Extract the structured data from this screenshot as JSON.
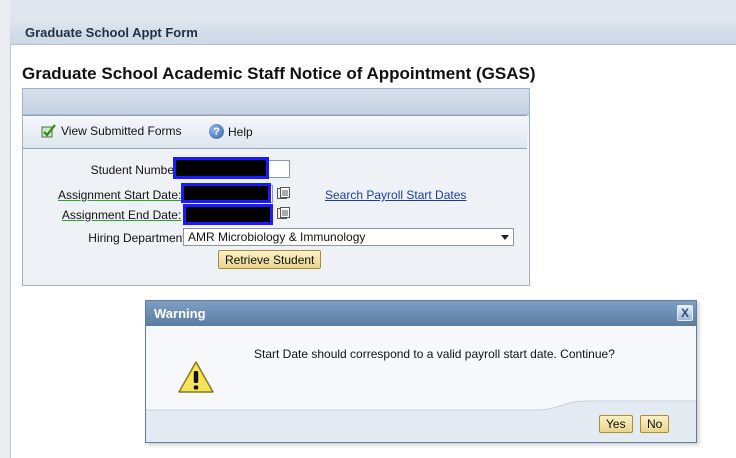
{
  "window_title": "Graduate School Appt Form",
  "page_title": "Graduate School Academic Staff Notice of Appointment (GSAS)",
  "toolbar": {
    "view_submitted": "View Submitted Forms",
    "help": "Help"
  },
  "form": {
    "student_number_label": "Student Number:",
    "start_date_label": "Assignment Start Date:",
    "end_date_label": "Assignment End Date:",
    "hiring_dept_label": "Hiring Department:",
    "required_mark": "*",
    "search_link": "Search Payroll Start Dates",
    "hiring_dept_value": "AMR Microbiology & Immunology",
    "retrieve_button": "Retrieve Student"
  },
  "dialog": {
    "title": "Warning",
    "close": "X",
    "message": "Start Date should correspond to a valid payroll start date. Continue?",
    "yes": "Yes",
    "no": "No"
  },
  "colors": {
    "accent": "#5a7ca3",
    "required": "#cc0000",
    "link": "#1a3da0",
    "button": "#ead58b"
  },
  "icons": [
    "checkmark-icon",
    "help-icon",
    "calendar-icon",
    "warning-icon",
    "close-icon",
    "dropdown-arrow-icon"
  ]
}
